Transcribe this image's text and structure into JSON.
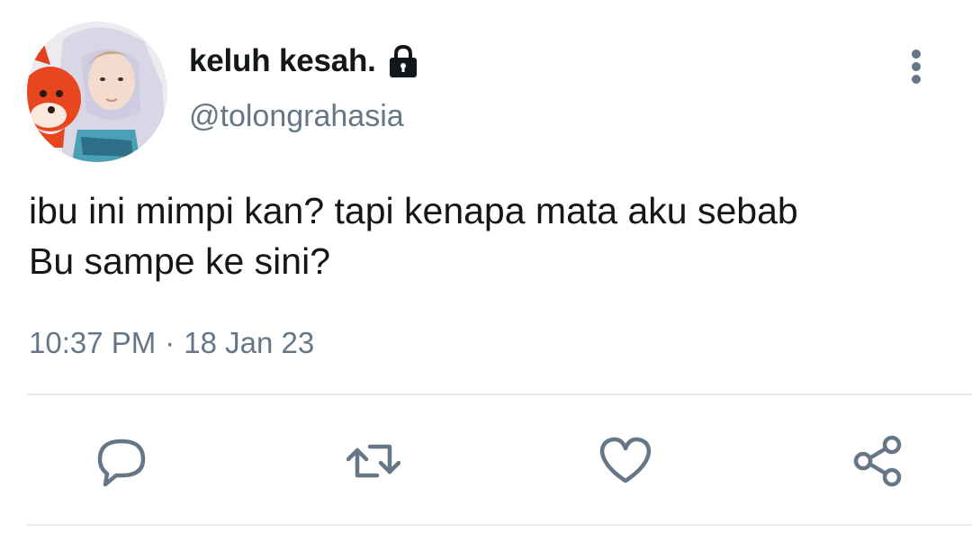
{
  "user": {
    "display_name": "keluh kesah.",
    "handle": "@tolongrahasia",
    "avatar_icon": "profile-photo",
    "protected_icon": "lock-icon"
  },
  "tweet": {
    "text": "ibu ini mimpi kan? tapi kenapa mata aku sebab\nBu sampe ke sini?",
    "time": "10:37 PM",
    "separator": "·",
    "date": "18 Jan 23"
  },
  "actions": {
    "reply_icon": "reply-icon",
    "retweet_icon": "retweet-icon",
    "like_icon": "heart-icon",
    "share_icon": "share-icon"
  },
  "colors": {
    "text_primary": "#14171a",
    "text_secondary": "#657786",
    "icon": "#657786",
    "divider": "#e6ecf0"
  }
}
